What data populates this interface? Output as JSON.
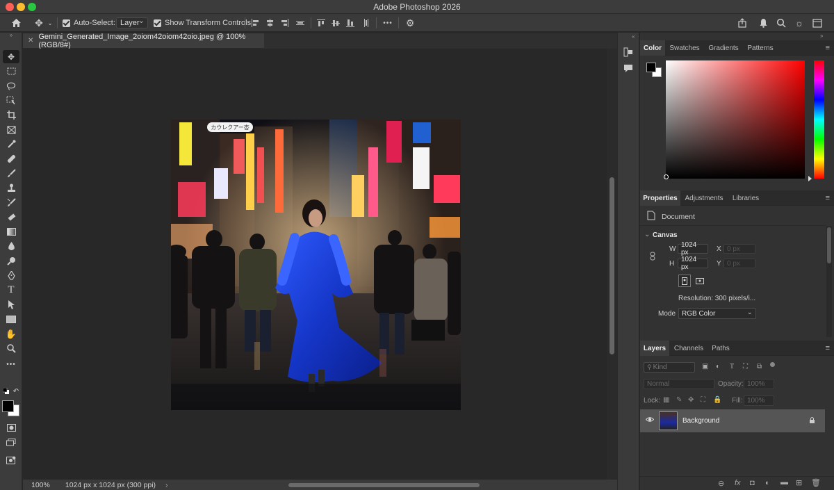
{
  "window": {
    "title": "Adobe Photoshop 2026"
  },
  "options_bar": {
    "auto_select_label": "Auto-Select:",
    "auto_select_value": "Layer",
    "show_transform_label": "Show Transform Controls",
    "more_label": "•••"
  },
  "document": {
    "tab_title": "Gemini_Generated_Image_2oiom42oiom42oio.jpeg @ 100% (RGB/8#)",
    "zoom": "100%",
    "info": "1024 px x 1024 px (300 ppi)",
    "sign_text": "カウレクアー杏"
  },
  "color_panel": {
    "tabs": [
      "Color",
      "Swatches",
      "Gradients",
      "Patterns"
    ],
    "foreground": "#000000",
    "background": "#ffffff",
    "hue": "#ff0000"
  },
  "properties_panel": {
    "tabs": [
      "Properties",
      "Adjustments",
      "Libraries"
    ],
    "doc_label": "Document",
    "canvas_label": "Canvas",
    "w_label": "W",
    "w_value": "1024 px",
    "h_label": "H",
    "h_value": "1024 px",
    "x_label": "X",
    "x_placeholder": "0 px",
    "y_label": "Y",
    "y_placeholder": "0 px",
    "resolution": "Resolution: 300 pixels/i...",
    "mode_label": "Mode",
    "mode_value": "RGB Color"
  },
  "layers_panel": {
    "tabs": [
      "Layers",
      "Channels",
      "Paths"
    ],
    "kind_placeholder": "Kind",
    "blend_mode": "Normal",
    "opacity_label": "Opacity:",
    "opacity_value": "100%",
    "lock_label": "Lock:",
    "fill_label": "Fill:",
    "fill_value": "100%",
    "layer_name": "Background"
  }
}
